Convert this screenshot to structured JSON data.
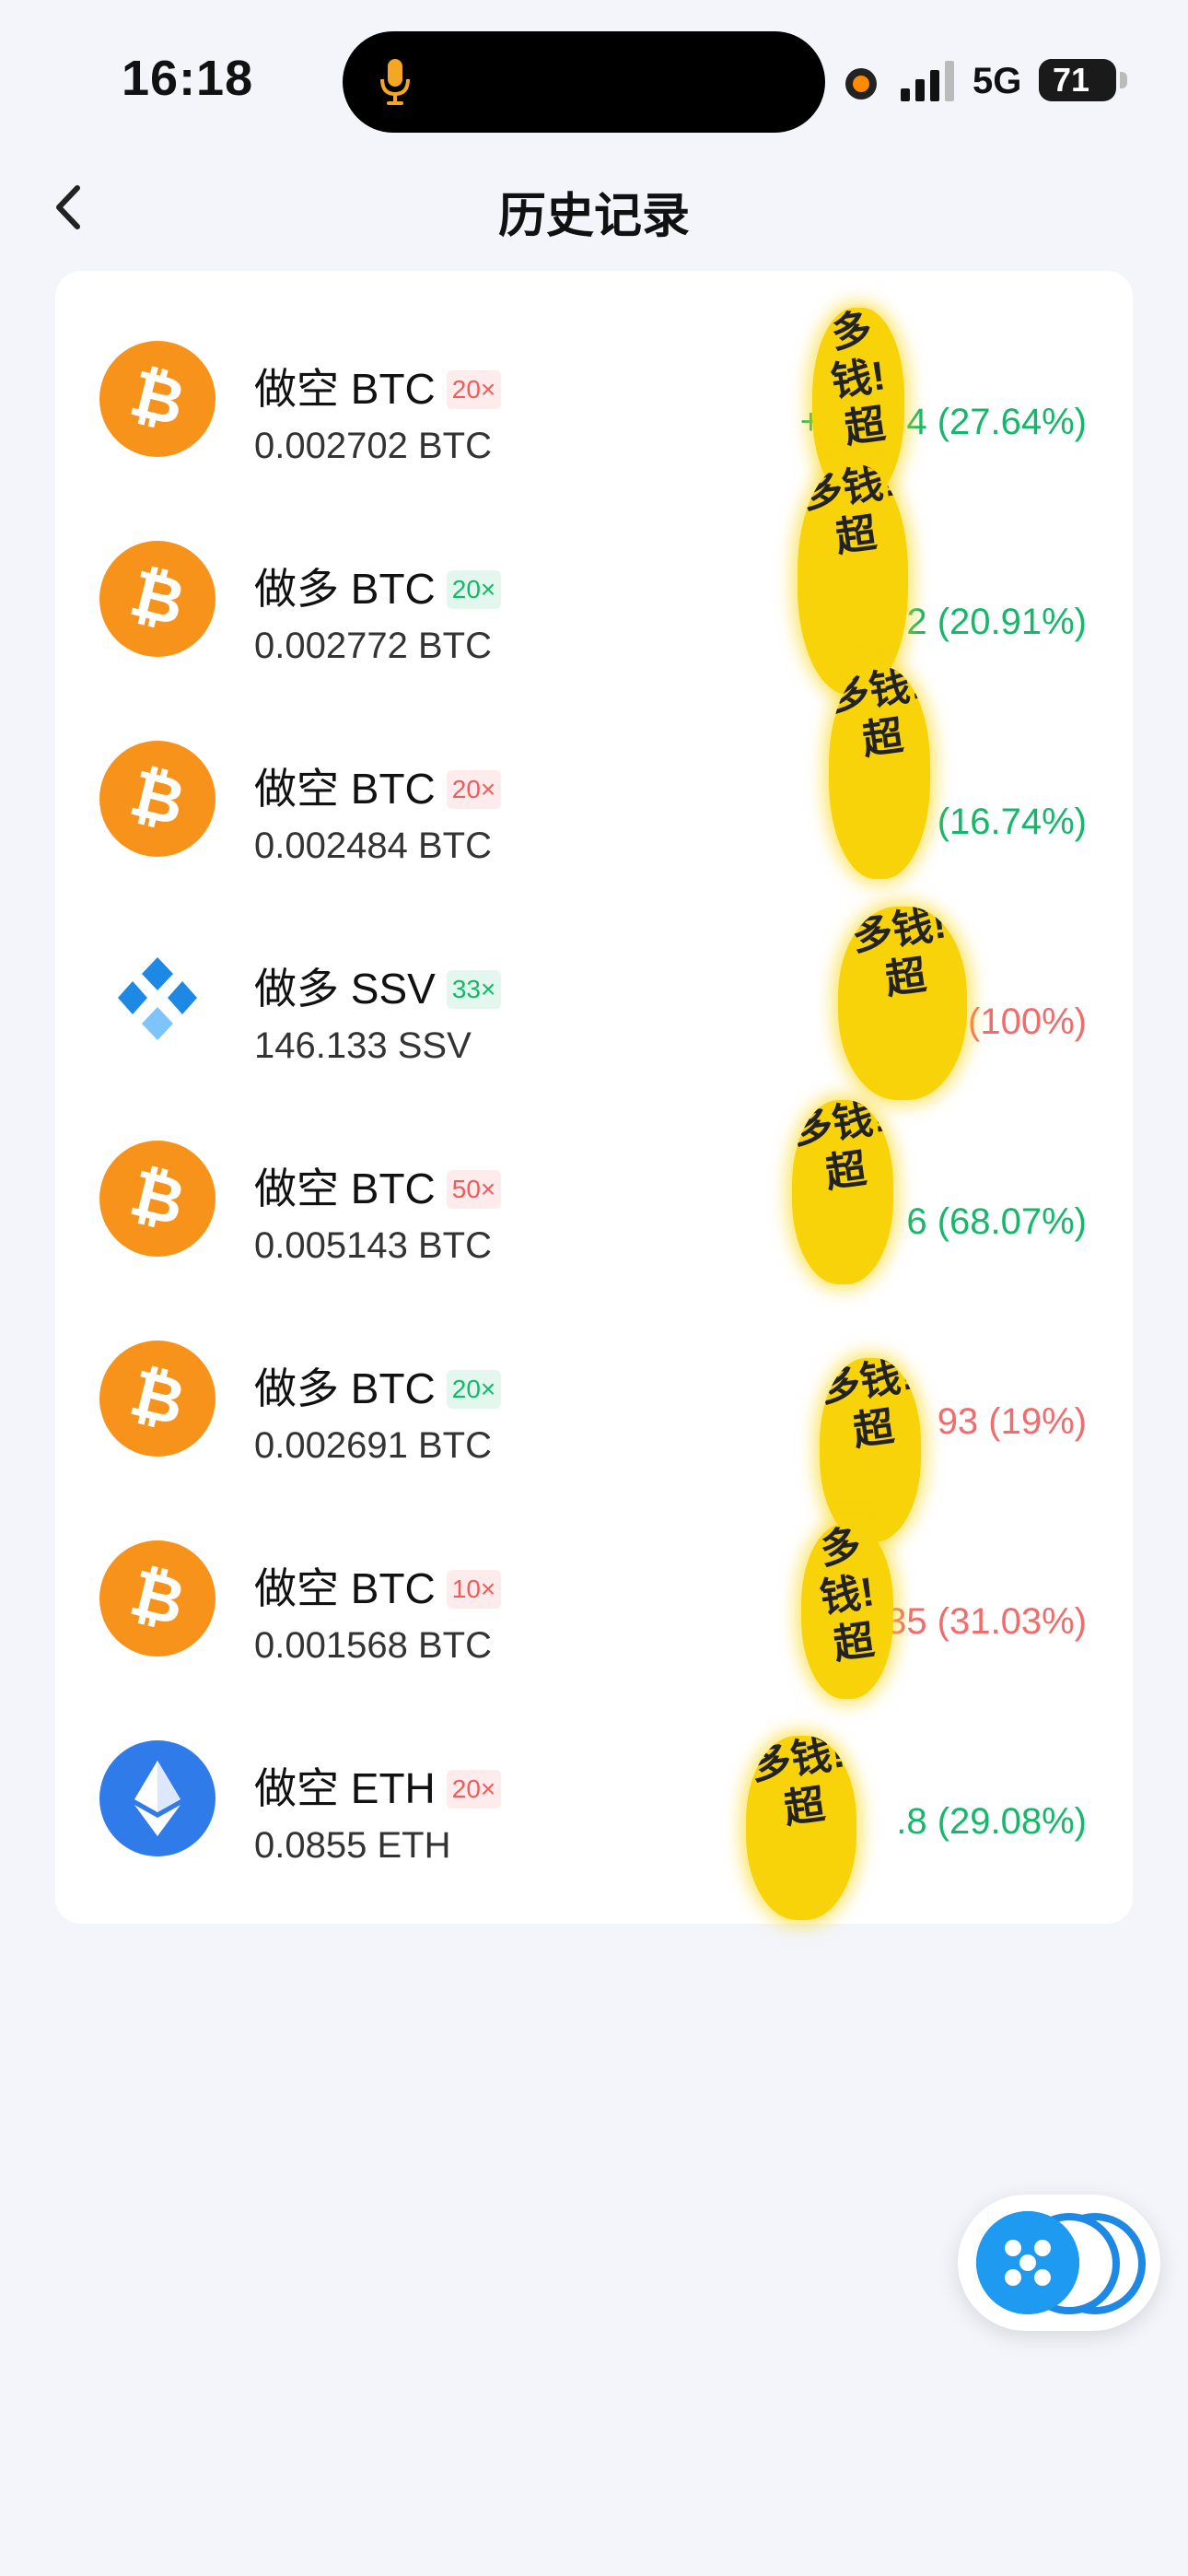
{
  "status_bar": {
    "time": "16:18",
    "network": "5G",
    "battery": "71",
    "battery_level": 0.71
  },
  "header": {
    "title": "历史记录"
  },
  "records": [
    {
      "title": "做空 BTC",
      "leverage": "20×",
      "side": "short",
      "amount": "0.002702 BTC",
      "pnl_prefix": "+$",
      "pnl_suffix": "4 (27.64%)",
      "direction": "up",
      "icon": "bitcoin-icon"
    },
    {
      "title": "做多 BTC",
      "leverage": "20×",
      "side": "long",
      "amount": "0.002772 BTC",
      "pnl_prefix": "+$",
      "pnl_suffix": "2 (20.91%)",
      "direction": "up",
      "icon": "bitcoin-icon"
    },
    {
      "title": "做空 BTC",
      "leverage": "20×",
      "side": "short",
      "amount": "0.002484 BTC",
      "pnl_prefix": "+",
      "pnl_suffix": "(16.74%)",
      "direction": "up",
      "icon": "bitcoin-icon"
    },
    {
      "title": "做多 SSV",
      "leverage": "33×",
      "side": "long",
      "amount": "146.133 SSV",
      "pnl_prefix": "-$",
      "pnl_suffix": "(100%)",
      "direction": "down",
      "icon": "ssv-icon"
    },
    {
      "title": "做空 BTC",
      "leverage": "50×",
      "side": "short",
      "amount": "0.005143 BTC",
      "pnl_prefix": "+",
      "pnl_suffix": "6 (68.07%)",
      "direction": "up",
      "icon": "bitcoin-icon"
    },
    {
      "title": "做多 BTC",
      "leverage": "20×",
      "side": "long",
      "amount": "0.002691 BTC",
      "pnl_prefix": "",
      "pnl_suffix": "93 (19%)",
      "direction": "down",
      "icon": "bitcoin-icon"
    },
    {
      "title": "做空 BTC",
      "leverage": "10×",
      "side": "short",
      "amount": "0.001568 BTC",
      "pnl_prefix": "-",
      "pnl_suffix": "35 (31.03%)",
      "direction": "down",
      "icon": "bitcoin-icon"
    },
    {
      "title": "做空 ETH",
      "leverage": "20×",
      "side": "short",
      "amount": "0.0855 ETH",
      "pnl_prefix": "",
      "pnl_suffix": ".8 (29.08%)",
      "direction": "up",
      "icon": "ethereum-icon"
    }
  ],
  "sticker_text": "多钱!超",
  "colors": {
    "profit": "#15b86a",
    "loss": "#f16c6c",
    "btc": "#f7931a",
    "eth": "#2f7bea",
    "sticker": "#f8d30a"
  }
}
